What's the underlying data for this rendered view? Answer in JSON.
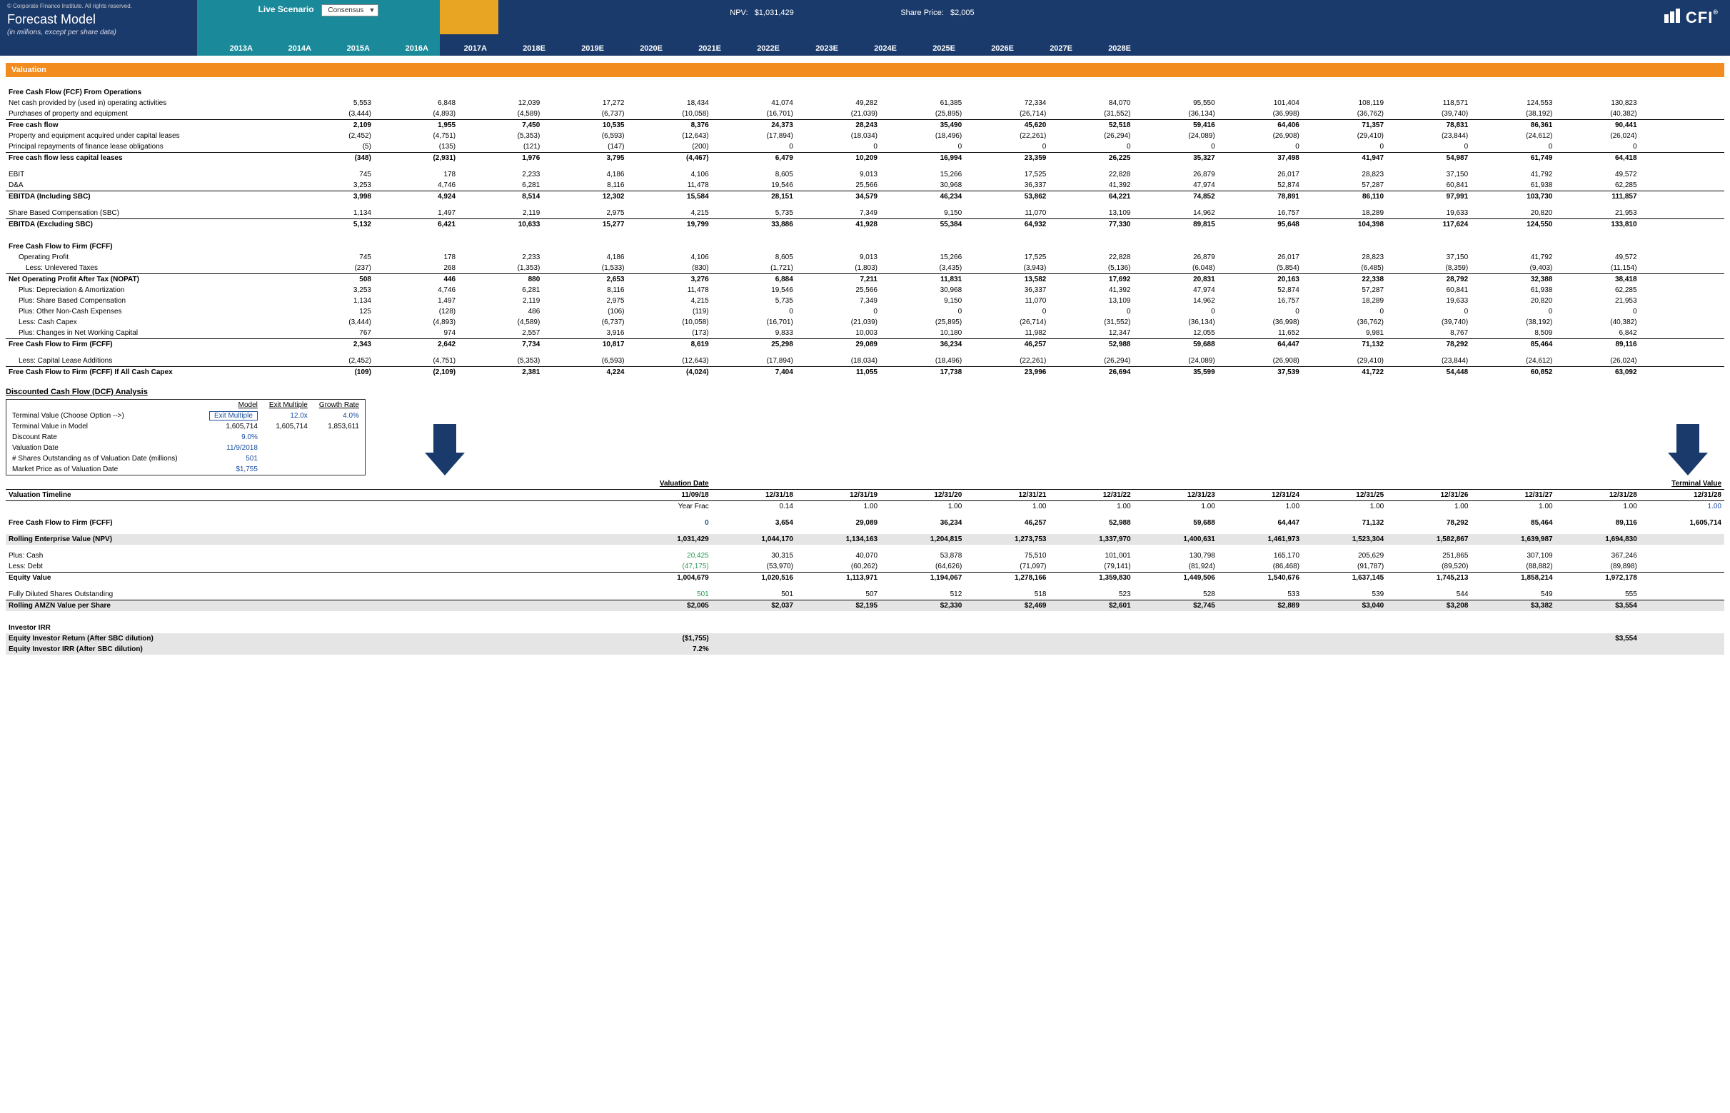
{
  "header": {
    "copyright": "© Corporate Finance Institute. All rights reserved.",
    "title": "Forecast Model",
    "subtitle": "(in millions, except per share data)",
    "live_scenario_label": "Live Scenario",
    "dropdown_value": "Consensus",
    "npv_label": "NPV:",
    "npv_value": "$1,031,429",
    "sp_label": "Share Price:",
    "sp_value": "$2,005",
    "logo": "CFI",
    "years": [
      "2013A",
      "2014A",
      "2015A",
      "2016A",
      "2017A",
      "2018E",
      "2019E",
      "2020E",
      "2021E",
      "2022E",
      "2023E",
      "2024E",
      "2025E",
      "2026E",
      "2027E",
      "2028E"
    ]
  },
  "section_valuation": "Valuation",
  "rows": {
    "fcf_ops_head": "Free Cash Flow (FCF) From Operations",
    "net_cash": {
      "label": "Net cash provided by (used in) operating activities",
      "v": [
        "5,553",
        "6,848",
        "12,039",
        "17,272",
        "18,434",
        "41,074",
        "49,282",
        "61,385",
        "72,334",
        "84,070",
        "95,550",
        "101,404",
        "108,119",
        "118,571",
        "124,553",
        "130,823"
      ]
    },
    "purchases": {
      "label": "Purchases of property and equipment",
      "v": [
        "(3,444)",
        "(4,893)",
        "(4,589)",
        "(6,737)",
        "(10,058)",
        "(16,701)",
        "(21,039)",
        "(25,895)",
        "(26,714)",
        "(31,552)",
        "(36,134)",
        "(36,998)",
        "(36,762)",
        "(39,740)",
        "(38,192)",
        "(40,382)"
      ]
    },
    "fcf": {
      "label": "Free cash flow",
      "v": [
        "2,109",
        "1,955",
        "7,450",
        "10,535",
        "8,376",
        "24,373",
        "28,243",
        "35,490",
        "45,620",
        "52,518",
        "59,416",
        "64,406",
        "71,357",
        "78,831",
        "86,361",
        "90,441"
      ]
    },
    "ppe_leases": {
      "label": "Property and equipment acquired under capital leases",
      "v": [
        "(2,452)",
        "(4,751)",
        "(5,353)",
        "(6,593)",
        "(12,643)",
        "(17,894)",
        "(18,034)",
        "(18,496)",
        "(22,261)",
        "(26,294)",
        "(24,089)",
        "(26,908)",
        "(29,410)",
        "(23,844)",
        "(24,612)",
        "(26,024)"
      ]
    },
    "principal": {
      "label": "Principal repayments of finance lease obligations",
      "v": [
        "(5)",
        "(135)",
        "(121)",
        "(147)",
        "(200)",
        "0",
        "0",
        "0",
        "0",
        "0",
        "0",
        "0",
        "0",
        "0",
        "0",
        "0"
      ]
    },
    "fcf_less_cl": {
      "label": "Free cash flow less capital leases",
      "v": [
        "(348)",
        "(2,931)",
        "1,976",
        "3,795",
        "(4,467)",
        "6,479",
        "10,209",
        "16,994",
        "23,359",
        "26,225",
        "35,327",
        "37,498",
        "41,947",
        "54,987",
        "61,749",
        "64,418"
      ]
    },
    "ebit": {
      "label": "EBIT",
      "v": [
        "745",
        "178",
        "2,233",
        "4,186",
        "4,106",
        "8,605",
        "9,013",
        "15,266",
        "17,525",
        "22,828",
        "26,879",
        "26,017",
        "28,823",
        "37,150",
        "41,792",
        "49,572"
      ]
    },
    "da": {
      "label": "D&A",
      "v": [
        "3,253",
        "4,746",
        "6,281",
        "8,116",
        "11,478",
        "19,546",
        "25,566",
        "30,968",
        "36,337",
        "41,392",
        "47,974",
        "52,874",
        "57,287",
        "60,841",
        "61,938",
        "62,285"
      ]
    },
    "ebitda_inc": {
      "label": "EBITDA (Including SBC)",
      "v": [
        "3,998",
        "4,924",
        "8,514",
        "12,302",
        "15,584",
        "28,151",
        "34,579",
        "46,234",
        "53,862",
        "64,221",
        "74,852",
        "78,891",
        "86,110",
        "97,991",
        "103,730",
        "111,857"
      ]
    },
    "sbc": {
      "label": "Share Based Compensation (SBC)",
      "v": [
        "1,134",
        "1,497",
        "2,119",
        "2,975",
        "4,215",
        "5,735",
        "7,349",
        "9,150",
        "11,070",
        "13,109",
        "14,962",
        "16,757",
        "18,289",
        "19,633",
        "20,820",
        "21,953"
      ]
    },
    "ebitda_ex": {
      "label": "EBITDA (Excluding SBC)",
      "v": [
        "5,132",
        "6,421",
        "10,633",
        "15,277",
        "19,799",
        "33,886",
        "41,928",
        "55,384",
        "64,932",
        "77,330",
        "89,815",
        "95,648",
        "104,398",
        "117,624",
        "124,550",
        "133,810"
      ]
    },
    "fcff_head": "Free Cash Flow to Firm (FCFF)",
    "op_profit": {
      "label": "Operating Profit",
      "v": [
        "745",
        "178",
        "2,233",
        "4,186",
        "4,106",
        "8,605",
        "9,013",
        "15,266",
        "17,525",
        "22,828",
        "26,879",
        "26,017",
        "28,823",
        "37,150",
        "41,792",
        "49,572"
      ]
    },
    "unlev_tax": {
      "label": "Less: Unlevered Taxes",
      "v": [
        "(237)",
        "268",
        "(1,353)",
        "(1,533)",
        "(830)",
        "(1,721)",
        "(1,803)",
        "(3,435)",
        "(3,943)",
        "(5,136)",
        "(6,048)",
        "(5,854)",
        "(6,485)",
        "(8,359)",
        "(9,403)",
        "(11,154)"
      ]
    },
    "nopat": {
      "label": "Net Operating Profit After Tax (NOPAT)",
      "v": [
        "508",
        "446",
        "880",
        "2,653",
        "3,276",
        "6,884",
        "7,211",
        "11,831",
        "13,582",
        "17,692",
        "20,831",
        "20,163",
        "22,338",
        "28,792",
        "32,388",
        "38,418"
      ]
    },
    "plus_da": {
      "label": "Plus: Depreciation & Amortization",
      "v": [
        "3,253",
        "4,746",
        "6,281",
        "8,116",
        "11,478",
        "19,546",
        "25,566",
        "30,968",
        "36,337",
        "41,392",
        "47,974",
        "52,874",
        "57,287",
        "60,841",
        "61,938",
        "62,285"
      ]
    },
    "plus_sbc": {
      "label": "Plus: Share Based Compensation",
      "v": [
        "1,134",
        "1,497",
        "2,119",
        "2,975",
        "4,215",
        "5,735",
        "7,349",
        "9,150",
        "11,070",
        "13,109",
        "14,962",
        "16,757",
        "18,289",
        "19,633",
        "20,820",
        "21,953"
      ]
    },
    "plus_other": {
      "label": "Plus: Other Non-Cash Expenses",
      "v": [
        "125",
        "(128)",
        "486",
        "(106)",
        "(119)",
        "0",
        "0",
        "0",
        "0",
        "0",
        "0",
        "0",
        "0",
        "0",
        "0",
        "0"
      ]
    },
    "less_capex": {
      "label": "Less: Cash Capex",
      "v": [
        "(3,444)",
        "(4,893)",
        "(4,589)",
        "(6,737)",
        "(10,058)",
        "(16,701)",
        "(21,039)",
        "(25,895)",
        "(26,714)",
        "(31,552)",
        "(36,134)",
        "(36,998)",
        "(36,762)",
        "(39,740)",
        "(38,192)",
        "(40,382)"
      ]
    },
    "plus_nwc": {
      "label": "Plus: Changes in Net Working Capital",
      "v": [
        "767",
        "974",
        "2,557",
        "3,916",
        "(173)",
        "9,833",
        "10,003",
        "10,180",
        "11,982",
        "12,347",
        "12,055",
        "11,652",
        "9,981",
        "8,767",
        "8,509",
        "6,842"
      ]
    },
    "fcff": {
      "label": "Free Cash Flow to Firm (FCFF)",
      "v": [
        "2,343",
        "2,642",
        "7,734",
        "10,817",
        "8,619",
        "25,298",
        "29,089",
        "36,234",
        "46,257",
        "52,988",
        "59,688",
        "64,447",
        "71,132",
        "78,292",
        "85,464",
        "89,116"
      ]
    },
    "less_cla": {
      "label": "Less: Capital Lease Additions",
      "v": [
        "(2,452)",
        "(4,751)",
        "(5,353)",
        "(6,593)",
        "(12,643)",
        "(17,894)",
        "(18,034)",
        "(18,496)",
        "(22,261)",
        "(26,294)",
        "(24,089)",
        "(26,908)",
        "(29,410)",
        "(23,844)",
        "(24,612)",
        "(26,024)"
      ]
    },
    "fcff_all": {
      "label": "Free Cash Flow to Firm (FCFF) If All Cash Capex",
      "v": [
        "(109)",
        "(2,109)",
        "2,381",
        "4,224",
        "(4,024)",
        "7,404",
        "11,055",
        "17,738",
        "23,996",
        "26,694",
        "35,599",
        "37,539",
        "41,722",
        "54,448",
        "60,852",
        "63,092"
      ]
    }
  },
  "dcf": {
    "head": "Discounted Cash Flow (DCF) Analysis",
    "cols": [
      "Model",
      "Exit Multiple",
      "Growth Rate"
    ],
    "tv_choose": {
      "label": "Terminal Value (Choose Option -->)",
      "opt": "Exit Multiple",
      "em": "12.0x",
      "gr": "4.0%"
    },
    "tv_model": {
      "label": "Terminal Value in Model",
      "model": "1,605,714",
      "em": "1,605,714",
      "gr": "1,853,611"
    },
    "disc_rate": {
      "label": "Discount Rate",
      "v": "9.0%"
    },
    "val_date": {
      "label": "Valuation Date",
      "v": "11/9/2018"
    },
    "shares": {
      "label": "# Shares Outstanding as of Valuation Date (millions)",
      "v": "501"
    },
    "mkt_price": {
      "label": "Market Price as of Valuation Date",
      "v": "$1,755"
    }
  },
  "timeline": {
    "val_date_head": "Valuation Date",
    "terminal_head": "Terminal Value",
    "head_label": "Valuation Timeline",
    "dates": [
      "11/09/18",
      "12/31/18",
      "12/31/19",
      "12/31/20",
      "12/31/21",
      "12/31/22",
      "12/31/23",
      "12/31/24",
      "12/31/25",
      "12/31/26",
      "12/31/27",
      "12/31/28",
      "12/31/28"
    ],
    "year_frac_label": "Year Frac",
    "year_frac": [
      "",
      "0.14",
      "1.00",
      "1.00",
      "1.00",
      "1.00",
      "1.00",
      "1.00",
      "1.00",
      "1.00",
      "1.00",
      "1.00",
      "1.00"
    ],
    "fcff_label": "Free Cash Flow to Firm (FCFF)",
    "fcff": [
      "0",
      "3,654",
      "29,089",
      "36,234",
      "46,257",
      "52,988",
      "59,688",
      "64,447",
      "71,132",
      "78,292",
      "85,464",
      "89,116",
      "1,605,714"
    ],
    "ev_label": "Rolling Enterprise Value (NPV)",
    "ev": [
      "1,031,429",
      "1,044,170",
      "1,134,163",
      "1,204,815",
      "1,273,753",
      "1,337,970",
      "1,400,631",
      "1,461,973",
      "1,523,304",
      "1,582,867",
      "1,639,987",
      "1,694,830",
      ""
    ],
    "plus_cash_label": "Plus: Cash",
    "plus_cash": [
      "20,425",
      "30,315",
      "40,070",
      "53,878",
      "75,510",
      "101,001",
      "130,798",
      "165,170",
      "205,629",
      "251,865",
      "307,109",
      "367,246",
      ""
    ],
    "less_debt_label": "Less: Debt",
    "less_debt": [
      "(47,175)",
      "(53,970)",
      "(60,262)",
      "(64,626)",
      "(71,097)",
      "(79,141)",
      "(81,924)",
      "(86,468)",
      "(91,787)",
      "(89,520)",
      "(88,882)",
      "(89,898)",
      ""
    ],
    "equity_label": "Equity Value",
    "equity": [
      "1,004,679",
      "1,020,516",
      "1,113,971",
      "1,194,067",
      "1,278,166",
      "1,359,830",
      "1,449,506",
      "1,540,676",
      "1,637,145",
      "1,745,213",
      "1,858,214",
      "1,972,178",
      ""
    ],
    "fdso_label": "Fully Diluted Shares Outstanding",
    "fdso": [
      "501",
      "501",
      "507",
      "512",
      "518",
      "523",
      "528",
      "533",
      "539",
      "544",
      "549",
      "555",
      ""
    ],
    "rps_label": "Rolling AMZN Value per Share",
    "rps": [
      "$2,005",
      "$2,037",
      "$2,195",
      "$2,330",
      "$2,469",
      "$2,601",
      "$2,745",
      "$2,889",
      "$3,040",
      "$3,208",
      "$3,382",
      "$3,554",
      ""
    ]
  },
  "irr": {
    "head": "Investor IRR",
    "ret_label": "Equity Investor Return (After SBC dilution)",
    "ret_start": "($1,755)",
    "ret_end": "$3,554",
    "irr_label": "Equity Investor IRR (After SBC dilution)",
    "irr_val": "7.2%"
  }
}
